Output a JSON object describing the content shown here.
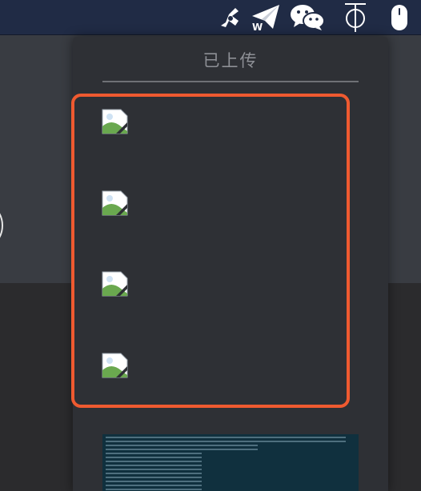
{
  "menubar": {
    "icons": [
      "vpn-fan-icon",
      "paper-plane-w-icon",
      "wechat-icon",
      "text-cursor-icon",
      "mouse-icon"
    ]
  },
  "panel": {
    "title": "已上传",
    "accent_color": "#ef5a30",
    "items": [
      {
        "icon": "broken-image-icon"
      },
      {
        "icon": "broken-image-icon"
      },
      {
        "icon": "broken-image-icon"
      },
      {
        "icon": "broken-image-icon"
      }
    ],
    "preview": {
      "icon": "terminal-screenshot"
    }
  }
}
